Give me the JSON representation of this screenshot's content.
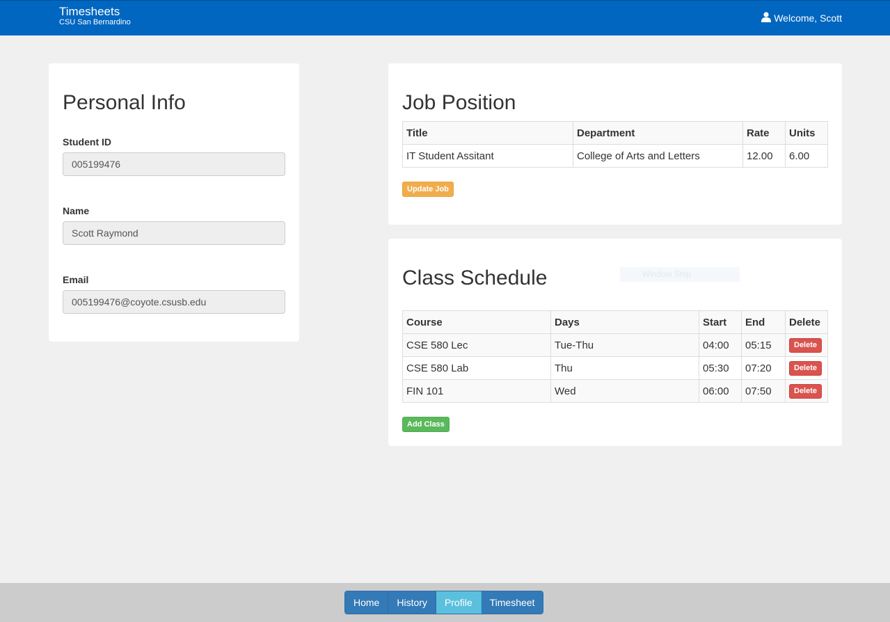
{
  "navbar": {
    "title": "Timesheets",
    "subtitle": "CSU San Bernardino",
    "welcome": "Welcome, Scott",
    "user_icon": "user-icon",
    "color": "#0066c0"
  },
  "personal": {
    "heading": "Personal Info",
    "student_id_label": "Student ID",
    "student_id_value": "005199476",
    "name_label": "Name",
    "name_value": "Scott Raymond",
    "email_label": "Email",
    "email_value": "005199476@coyote.csusb.edu"
  },
  "job": {
    "heading": "Job Position",
    "columns": [
      "Title",
      "Department",
      "Rate",
      "Units"
    ],
    "rows": [
      [
        "IT Student Assitant",
        "College of Arts and Letters",
        "12.00",
        "6.00"
      ]
    ],
    "update_button": "Update Job"
  },
  "classes": {
    "heading": "Class Schedule",
    "columns": [
      "Course",
      "Days",
      "Start",
      "End",
      "Delete"
    ],
    "rows": [
      {
        "course": "CSE 580 Lec",
        "days": "Tue-Thu",
        "start": "04:00",
        "end": "05:15",
        "delete": "Delete"
      },
      {
        "course": "CSE 580 Lab",
        "days": "Thu",
        "start": "05:30",
        "end": "07:20",
        "delete": "Delete"
      },
      {
        "course": "FIN 101",
        "days": "Wed",
        "start": "06:00",
        "end": "07:50",
        "delete": "Delete"
      }
    ],
    "add_button": "Add Class"
  },
  "overlay": {
    "window_snip": "Window Snip"
  },
  "footer": {
    "buttons": [
      "Home",
      "History",
      "Profile",
      "Timesheet"
    ],
    "active": "Profile"
  }
}
